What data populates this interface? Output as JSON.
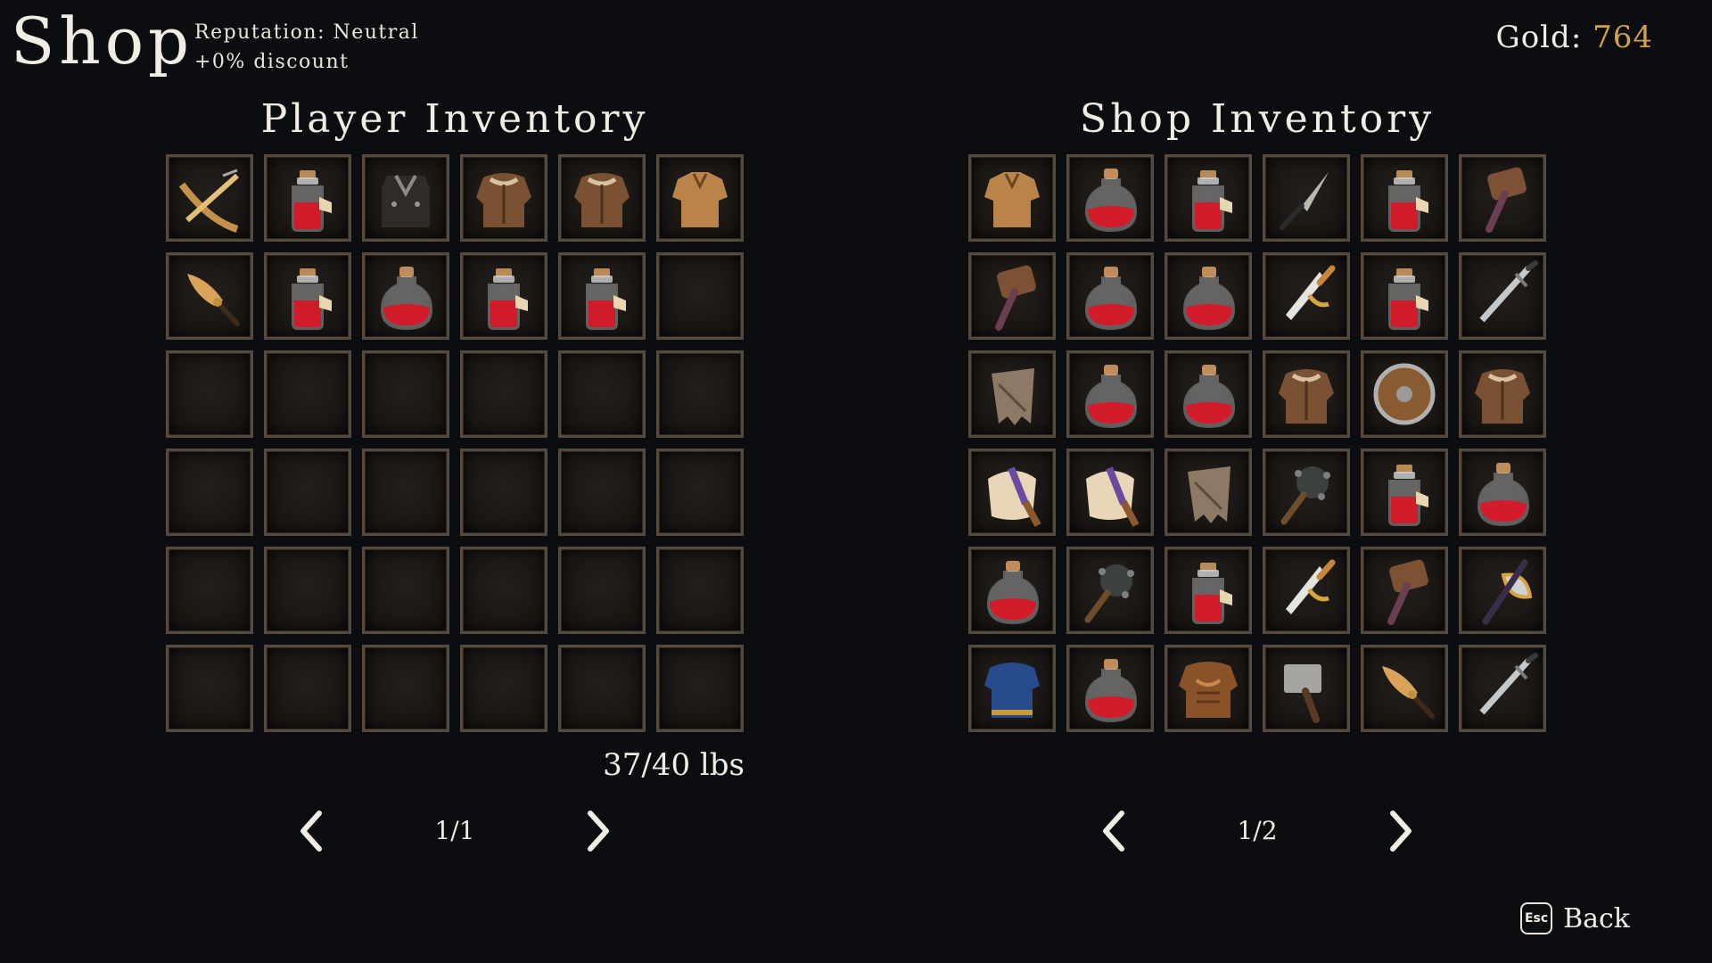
{
  "header": {
    "title": "Shop",
    "reputation": "Reputation: Neutral",
    "discount": "+0% discount",
    "gold_label": "Gold:",
    "gold_value": "764"
  },
  "player_inventory": {
    "title": "Player Inventory",
    "items": [
      "crossbow",
      "potion-flask",
      "leather-vest",
      "leather-armor",
      "leather-armor",
      "tunic",
      "feather-dagger",
      "potion-flask",
      "potion-round",
      "potion-flask",
      "potion-flask",
      "empty",
      "empty",
      "empty",
      "empty",
      "empty",
      "empty",
      "empty",
      "empty",
      "empty",
      "empty",
      "empty",
      "empty",
      "empty",
      "empty",
      "empty",
      "empty",
      "empty",
      "empty",
      "empty",
      "empty",
      "empty",
      "empty",
      "empty",
      "empty",
      "empty"
    ],
    "weight": "37/40 lbs",
    "page": "1/1"
  },
  "shop_inventory": {
    "title": "Shop Inventory",
    "items": [
      "tunic",
      "potion-round",
      "potion-flask",
      "dagger",
      "potion-flask",
      "hammer",
      "hammer",
      "potion-round",
      "potion-round",
      "short-sword",
      "potion-flask",
      "long-sword",
      "torn-cloak",
      "potion-round",
      "potion-round",
      "leather-armor",
      "round-shield",
      "leather-armor",
      "fur-cloak",
      "fur-cloak",
      "torn-cloak",
      "mace",
      "potion-flask",
      "potion-round",
      "potion-round",
      "mace",
      "potion-flask",
      "short-sword",
      "hammer",
      "axe",
      "blue-armor",
      "potion-round",
      "bronze-armor",
      "warhammer",
      "feather-dagger",
      "long-sword"
    ],
    "page": "1/2"
  },
  "footer": {
    "esc_key": "Esc",
    "back_label": "Back"
  },
  "colors": {
    "background": "#0b0d10",
    "gold": "#d2a24a",
    "slot_border": "#554a3d"
  }
}
